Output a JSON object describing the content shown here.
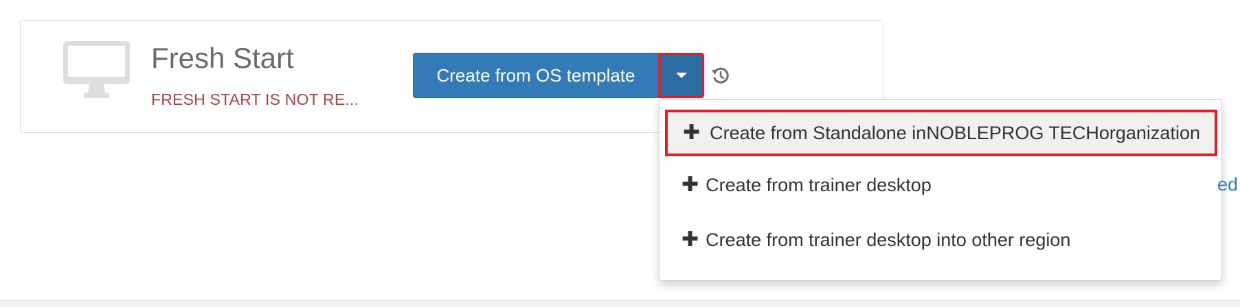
{
  "card": {
    "title": "Fresh Start",
    "status": "FRESH START IS NOT RE..."
  },
  "actions": {
    "create_button_label": "Create from OS template",
    "history_icon": "history-icon",
    "caret_icon": "caret-down-icon"
  },
  "dropdown": {
    "plus_glyph": "✚",
    "items": [
      {
        "label": "Create from Standalone inNOBLEPROG TECHorganization"
      },
      {
        "label": "Create from trainer desktop"
      },
      {
        "label": "Create from trainer desktop into other region"
      }
    ]
  },
  "edge_link": {
    "text": "ed"
  },
  "colors": {
    "primary": "#337ab7",
    "primary_dark": "#2e6da4",
    "danger_text": "#a94442",
    "highlight_border": "#d9232a"
  }
}
